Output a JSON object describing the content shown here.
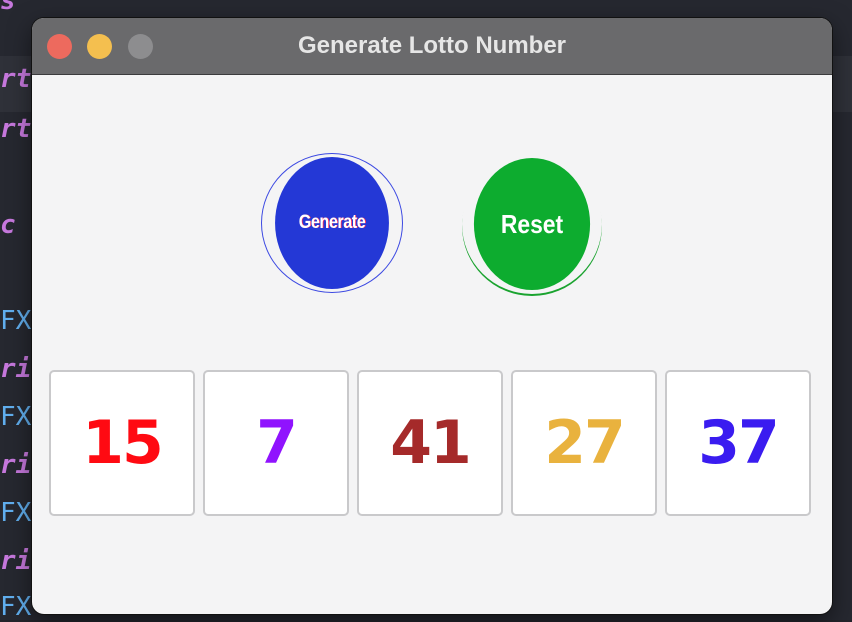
{
  "window": {
    "title": "Generate Lotto Number"
  },
  "buttons": {
    "generate_label": "Generate",
    "reset_label": "Reset"
  },
  "numbers": [
    {
      "value": "15",
      "color": "#ff0a12"
    },
    {
      "value": "7",
      "color": "#9013fe"
    },
    {
      "value": "41",
      "color": "#a52a2a"
    },
    {
      "value": "27",
      "color": "#e9b23e"
    },
    {
      "value": "37",
      "color": "#3a1cf0"
    }
  ],
  "colors": {
    "generate_button": "#2438d6",
    "reset_button": "#0dac2f",
    "titlebar": "#6a6a6c",
    "window_background": "#f4f4f5"
  },
  "background_editor": {
    "fragments": [
      "rt",
      "rt",
      "c",
      "FX",
      "ri",
      "FX",
      "ri",
      "FX",
      "ri",
      "FX"
    ]
  }
}
